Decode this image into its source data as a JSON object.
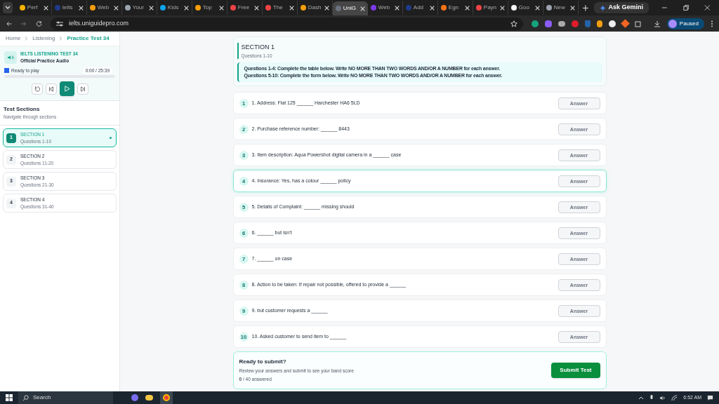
{
  "browser": {
    "tabs": [
      {
        "label": "Perf",
        "selected": false,
        "color": "#f4b400"
      },
      {
        "label": "Ielts",
        "selected": false,
        "color": "#1e3a8a"
      },
      {
        "label": "Web",
        "selected": false,
        "color": "#f59e0b"
      },
      {
        "label": "Your",
        "selected": false,
        "color": "#9ca3af"
      },
      {
        "label": "Kids",
        "selected": false,
        "color": "#0ea5e9"
      },
      {
        "label": "Top",
        "selected": false,
        "color": "#f59e0b"
      },
      {
        "label": "Free",
        "selected": false,
        "color": "#ef4444"
      },
      {
        "label": "The",
        "selected": false,
        "color": "#ef4444"
      },
      {
        "label": "Dash",
        "selected": false,
        "color": "#f59e0b"
      },
      {
        "label": "UniG",
        "selected": true,
        "color": "#6b7280"
      },
      {
        "label": "Web",
        "selected": false,
        "color": "#7c3aed"
      },
      {
        "label": "Add",
        "selected": false,
        "color": "#1e3a8a"
      },
      {
        "label": "Egn",
        "selected": false,
        "color": "#f97316"
      },
      {
        "label": "Payn",
        "selected": false,
        "color": "#ef4444"
      },
      {
        "label": "Goo",
        "selected": false,
        "color": "#f3f4f6"
      },
      {
        "label": "New",
        "selected": false,
        "color": "#9ca3af"
      }
    ],
    "ask_gemini": "Ask Gemini",
    "url": "ielts.uniguidepro.com",
    "profile": "Paused"
  },
  "breadcrumb": [
    {
      "label": "Home",
      "selected": false
    },
    {
      "label": "Listening",
      "selected": false
    },
    {
      "label": "Practice Test 34",
      "selected": true
    }
  ],
  "player": {
    "title": "IELTS LISTENING TEST 34",
    "subtitle": "Official Practice Audio",
    "status": "Ready to play",
    "time": "0:00 / 25:39",
    "level": 0
  },
  "sections_panel": {
    "title": "Test Sections",
    "subtitle": "Navigate through sections",
    "items": [
      {
        "number": "1",
        "title": "SECTION 1",
        "range": "Questions 1-10",
        "selected": true
      },
      {
        "number": "2",
        "title": "SECTION 2",
        "range": "Questions 11-20",
        "selected": false
      },
      {
        "number": "3",
        "title": "SECTION 3",
        "range": "Questions 21-30",
        "selected": false
      },
      {
        "number": "4",
        "title": "SECTION 4",
        "range": "Questions 31-40",
        "selected": false
      }
    ]
  },
  "section": {
    "title": "SECTION 1",
    "range": "Questions 1-10",
    "instructions": [
      "Questions 1-4: Complete the table below. Write NO MORE THAN TWO WORDS AND/OR A NUMBER for each answer.",
      "Questions 5-10: Complete the form below. Write NO MORE THAN TWO WORDS AND/OR A NUMBER for each answer."
    ]
  },
  "questions": [
    {
      "number": "1",
      "text": "1. Address: Flat 125 ______ Harchester HA6 5LD",
      "placeholder": "Answer",
      "selected": false
    },
    {
      "number": "2",
      "text": "2. Purchase reference number: ______ 8443",
      "placeholder": "Answer",
      "selected": false
    },
    {
      "number": "3",
      "text": "3. Item description: Aqua Powershot digital camera in a ______ case",
      "placeholder": "Answer",
      "selected": false
    },
    {
      "number": "4",
      "text": "4. Insurance: Yes, has a colour ______ policy",
      "placeholder": "Answer",
      "selected": true
    },
    {
      "number": "5",
      "text": "5. Details of Complaint: ______ missing should",
      "placeholder": "Answer",
      "selected": false
    },
    {
      "number": "6",
      "text": "6. ______ but isn't",
      "placeholder": "Answer",
      "selected": false
    },
    {
      "number": "7",
      "text": "7. ______ on case",
      "placeholder": "Answer",
      "selected": false
    },
    {
      "number": "8",
      "text": "8. Action to be taken: If repair not possible, offered to provide a ______",
      "placeholder": "Answer",
      "selected": false
    },
    {
      "number": "9",
      "text": "9. but customer requests a ______",
      "placeholder": "Answer",
      "selected": false
    },
    {
      "number": "10",
      "text": "10. Asked customer to send item to ______",
      "placeholder": "Answer",
      "selected": false
    }
  ],
  "submit": {
    "title": "Ready to submit?",
    "subtitle": "Review your answers and submit to see your band score",
    "count": "**0** / 40 answered",
    "button": "Submit Test"
  },
  "taskbar": {
    "search": "Search",
    "time": "6:52 AM"
  }
}
